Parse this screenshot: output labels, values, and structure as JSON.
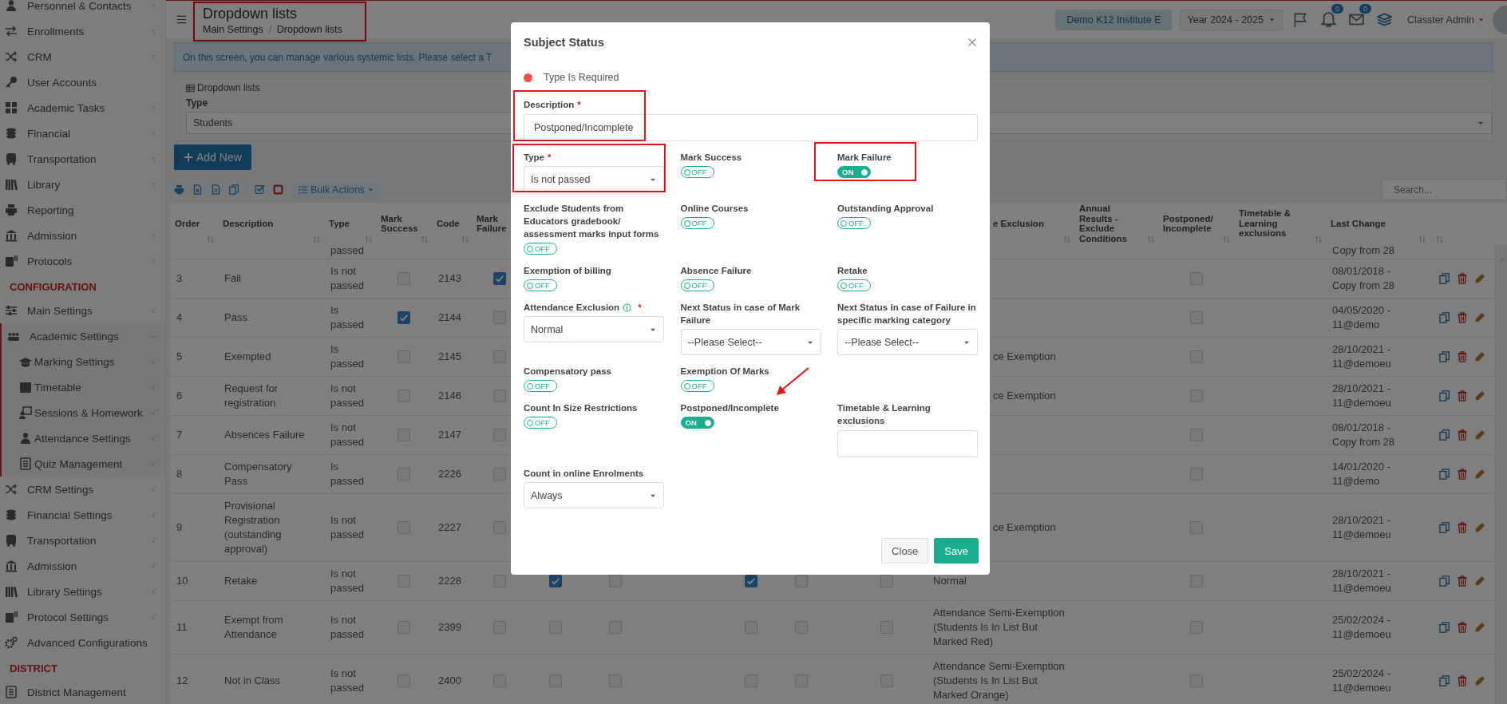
{
  "sidebar": {
    "sections": [
      {
        "items": [
          {
            "label": "Personnel & Contacts",
            "submenu": true,
            "expanded": false
          },
          {
            "label": "Enrollments",
            "submenu": true,
            "expanded": false
          },
          {
            "label": "CRM",
            "submenu": true,
            "expanded": false
          },
          {
            "label": "User Accounts",
            "submenu": false
          },
          {
            "label": "Academic Tasks",
            "submenu": true,
            "expanded": false
          },
          {
            "label": "Financial",
            "submenu": true,
            "expanded": false
          },
          {
            "label": "Transportation",
            "submenu": true,
            "expanded": false
          },
          {
            "label": "Library",
            "submenu": true,
            "expanded": false
          },
          {
            "label": "Reporting",
            "submenu": false
          },
          {
            "label": "Admission",
            "submenu": true,
            "expanded": false
          },
          {
            "label": "Protocols",
            "submenu": true,
            "expanded": false
          }
        ]
      },
      {
        "header": "CONFIGURATION",
        "items": [
          {
            "label": "Main Settings",
            "submenu": true,
            "expanded": false
          },
          {
            "label": "Academic Settings",
            "submenu": true,
            "expanded": true,
            "children": [
              {
                "label": "Marking Settings",
                "submenu": true,
                "expanded": false
              },
              {
                "label": "Timetable",
                "submenu": true,
                "expanded": false
              },
              {
                "label": "Sessions & Homework",
                "submenu": true,
                "expanded": false
              },
              {
                "label": "Attendance Settings",
                "submenu": true,
                "expanded": false
              },
              {
                "label": "Quiz Management",
                "submenu": true,
                "expanded": false
              }
            ]
          },
          {
            "label": "CRM Settings",
            "submenu": true,
            "expanded": false
          },
          {
            "label": "Financial Settings",
            "submenu": true,
            "expanded": false
          },
          {
            "label": "Transportation",
            "submenu": true,
            "expanded": false
          },
          {
            "label": "Admission",
            "submenu": true,
            "expanded": false
          },
          {
            "label": "Library Settings",
            "submenu": true,
            "expanded": false
          },
          {
            "label": "Protocol Settings",
            "submenu": true,
            "expanded": false
          },
          {
            "label": "Advanced Configurations",
            "submenu": false
          }
        ]
      },
      {
        "header": "DISTRICT",
        "items": [
          {
            "label": "District Management",
            "submenu": false
          }
        ]
      }
    ]
  },
  "header": {
    "title": "Dropdown lists",
    "highlighted": true,
    "breadcrumb": [
      "Main Settings",
      "Dropdown lists"
    ],
    "institute": "Demo K12 Institute E",
    "year": "Year 2024 - 2025",
    "notifications_badge": "0",
    "messages_badge": "0",
    "user": "Classter Admin"
  },
  "info_alert": "On this screen, you can manage various systemic lists. Please select a T",
  "filter_panel": {
    "title": "Dropdown lists",
    "type_label": "Type",
    "type_value": "Students"
  },
  "add_button": "Add New",
  "bulk_actions": "Bulk Actions",
  "search_placeholder": "Search...",
  "table": {
    "columns": [
      "Order",
      "Description",
      "Type",
      "Mark Success",
      "Code",
      "Mark Failure",
      "e Exclusion",
      "Annual Results - Exclude Conditions",
      "Postponed/ Incomplete",
      "Timetable & Learning exclusions",
      "Last Change"
    ],
    "rows": [
      {
        "type": "passed",
        "last_change": "Copy from 28"
      },
      {
        "order": "3",
        "description": "Fail",
        "type": "Is not passed",
        "mark_success": false,
        "code": "2143",
        "mark_failure": true,
        "postponed_incomplete": false,
        "last_change": "08/01/2018 - Copy from 28"
      },
      {
        "order": "4",
        "description": "Pass",
        "type": "Is passed",
        "mark_success": true,
        "code": "2144",
        "mark_failure": false,
        "postponed_incomplete": false,
        "last_change": "04/05/2020 - 11@demo"
      },
      {
        "order": "5",
        "description": "Exempted",
        "type": "Is passed",
        "mark_success": false,
        "code": "2145",
        "mark_failure": false,
        "attendance_exclusion": "ce Exemption",
        "postponed_incomplete": false,
        "last_change": "28/10/2021 - 11@demoeu"
      },
      {
        "order": "6",
        "description": "Request for registration",
        "type": "Is not passed",
        "mark_success": false,
        "code": "2146",
        "mark_failure": false,
        "attendance_exclusion": "ce Exemption",
        "postponed_incomplete": false,
        "last_change": "28/10/2021 - 11@demoeu"
      },
      {
        "order": "7",
        "description": "Absences Failure",
        "type": "Is not passed",
        "mark_success": false,
        "code": "2147",
        "mark_failure": false,
        "postponed_incomplete": false,
        "last_change": "08/01/2018 - Copy from 28"
      },
      {
        "order": "8",
        "description": "Compensatory Pass",
        "type": "Is passed",
        "mark_success": false,
        "code": "2226",
        "mark_failure": false,
        "postponed_incomplete": false,
        "last_change": "14/01/2020 - 11@demo"
      },
      {
        "order": "9",
        "description": "Provisional Registration (outstanding approval)",
        "type": "Is not passed",
        "mark_success": false,
        "code": "2227",
        "mark_failure": false,
        "attendance_exclusion": "ce Exemption",
        "postponed_incomplete": false,
        "last_change": "28/10/2021 - 11@demoeu"
      },
      {
        "order": "10",
        "description": "Retake",
        "type": "Is not passed",
        "mark_success": false,
        "code": "2228",
        "mark_failure": false,
        "column_7_checked": true,
        "column_8_checked": false,
        "column_10_checked": true,
        "column_11_checked": false,
        "column_13_checked": false,
        "attendance_exclusion": "Normal",
        "postponed_incomplete": false,
        "last_change": "28/10/2021 - 11@demoeu"
      },
      {
        "order": "11",
        "description": "Exempt from Attendance",
        "type": "Is not passed",
        "mark_success": false,
        "code": "2399",
        "mark_failure": false,
        "column_7_checked": false,
        "column_8_checked": false,
        "column_10_checked": false,
        "column_11_checked": false,
        "column_13_checked": false,
        "attendance_exclusion": "Attendance Semi-Exemption (Students Is In List But Marked Red)",
        "postponed_incomplete": false,
        "last_change": "25/02/2024 - 11@demoeu"
      },
      {
        "order": "12",
        "description": "Not in Class",
        "type": "Is not passed",
        "mark_success": false,
        "code": "2400",
        "mark_failure": false,
        "column_7_checked": false,
        "column_8_checked": false,
        "column_10_checked": false,
        "column_11_checked": false,
        "column_13_checked": false,
        "attendance_exclusion": "Attendance Semi-Exemption (Students Is In List But Marked Orange)",
        "postponed_incomplete": false,
        "last_change": "25/02/2024 - 11@demoeu"
      }
    ]
  },
  "modal": {
    "title": "Subject Status",
    "legend": "Type Is Required",
    "rows": [
      [
        {
          "kind": "text",
          "label": "Description",
          "required_mark": "*",
          "value": "Postponed/Incomplete",
          "highlighted": true
        }
      ],
      [
        {
          "kind": "select",
          "label": "Type",
          "required_mark": "*",
          "value": "Is not passed",
          "highlighted": true
        },
        {
          "kind": "toggle",
          "label": "Mark Success",
          "on": false,
          "state_label": "OFF"
        },
        {
          "kind": "toggle",
          "label": "Mark Failure",
          "on": true,
          "state_label": "ON",
          "highlighted": true
        }
      ],
      [
        {
          "kind": "toggle",
          "label": "Exclude Students from Educators gradebook/ assessment marks input forms",
          "on": false,
          "state_label": "OFF"
        },
        {
          "kind": "toggle",
          "label": "Online Courses",
          "on": false,
          "state_label": "OFF"
        },
        {
          "kind": "toggle",
          "label": "Outstanding Approval",
          "on": false,
          "state_label": "OFF"
        }
      ],
      [
        {
          "kind": "toggle",
          "label": "Exemption of billing",
          "on": false,
          "state_label": "OFF"
        },
        {
          "kind": "toggle",
          "label": "Absence Failure",
          "on": false,
          "state_label": "OFF"
        },
        {
          "kind": "toggle",
          "label": "Retake",
          "on": false,
          "state_label": "OFF"
        }
      ],
      [
        {
          "kind": "select",
          "label": "Attendance Exclusion",
          "info_icon": true,
          "required_mark": "*",
          "value": "Normal"
        },
        {
          "kind": "select",
          "label": "Next Status in case of Mark Failure",
          "value": "--Please Select--"
        },
        {
          "kind": "select",
          "label": "Next Status in case of Failure in specific marking category",
          "value": "--Please Select--"
        }
      ],
      [
        {
          "kind": "toggle",
          "label": "Compensatory pass",
          "on": false,
          "state_label": "OFF"
        },
        {
          "kind": "toggle",
          "label": "Exemption Of Marks",
          "on": false,
          "state_label": "OFF"
        }
      ],
      [
        {
          "kind": "toggle",
          "label": "Count In Size Restrictions",
          "on": false,
          "state_label": "OFF"
        },
        {
          "kind": "toggle",
          "label": "Postponed/Incomplete",
          "on": true,
          "state_label": "ON",
          "pointed_at": true
        },
        {
          "kind": "text",
          "label": "Timetable & Learning exclusions"
        }
      ],
      [
        {
          "kind": "select",
          "label": "Count in online Enrolments",
          "value": "Always"
        }
      ]
    ],
    "buttons": [
      {
        "label": "Close",
        "kind": "secondary"
      },
      {
        "label": "Save",
        "kind": "primary"
      }
    ]
  }
}
